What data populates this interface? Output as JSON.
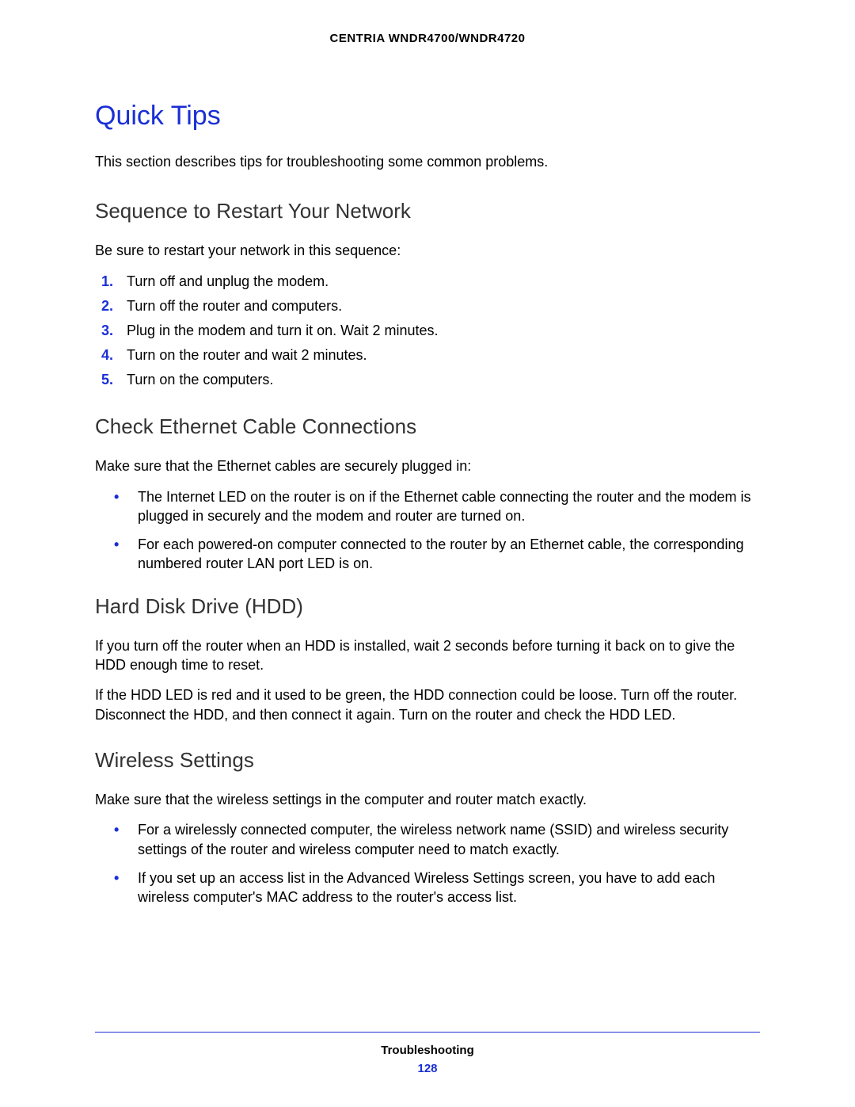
{
  "header": "CENTRIA WNDR4700/WNDR4720",
  "title": "Quick Tips",
  "intro": "This section describes tips for troubleshooting some common problems.",
  "sections": {
    "restart": {
      "heading": "Sequence to Restart Your Network",
      "lead": "Be sure to restart your network in this sequence:",
      "items": [
        "Turn off and unplug the modem.",
        "Turn off the router and computers.",
        "Plug in the modem and turn it on. Wait 2 minutes.",
        "Turn on the router and wait 2 minutes.",
        "Turn on the computers."
      ]
    },
    "ethernet": {
      "heading": "Check Ethernet Cable Connections",
      "lead": "Make sure that the Ethernet cables are securely plugged in:",
      "items": [
        "The Internet LED on the router is on if the Ethernet cable connecting the router and the modem is plugged in securely and the modem and router are turned on.",
        "For each powered-on computer connected to the router by an Ethernet cable, the corresponding numbered router LAN port LED is on."
      ]
    },
    "hdd": {
      "heading": "Hard Disk Drive (HDD)",
      "p1": "If you turn off the router when an HDD is installed, wait 2 seconds before turning it back on to give the HDD enough time to reset.",
      "p2": "If the HDD LED is red and it used to be green, the HDD connection could be loose. Turn off the router. Disconnect the HDD, and then connect it again. Turn on the router and check the HDD LED."
    },
    "wireless": {
      "heading": "Wireless Settings",
      "lead": "Make sure that the wireless settings in the computer and router match exactly.",
      "items": [
        "For a wirelessly connected computer, the wireless network name (SSID) and wireless security settings of the router and wireless computer need to match exactly.",
        "If you set up an access list in the Advanced Wireless Settings screen, you have to add each wireless computer's MAC address to the router's access list."
      ]
    }
  },
  "footer": {
    "section": "Troubleshooting",
    "page": "128"
  },
  "numbers": [
    "1.",
    "2.",
    "3.",
    "4.",
    "5."
  ]
}
